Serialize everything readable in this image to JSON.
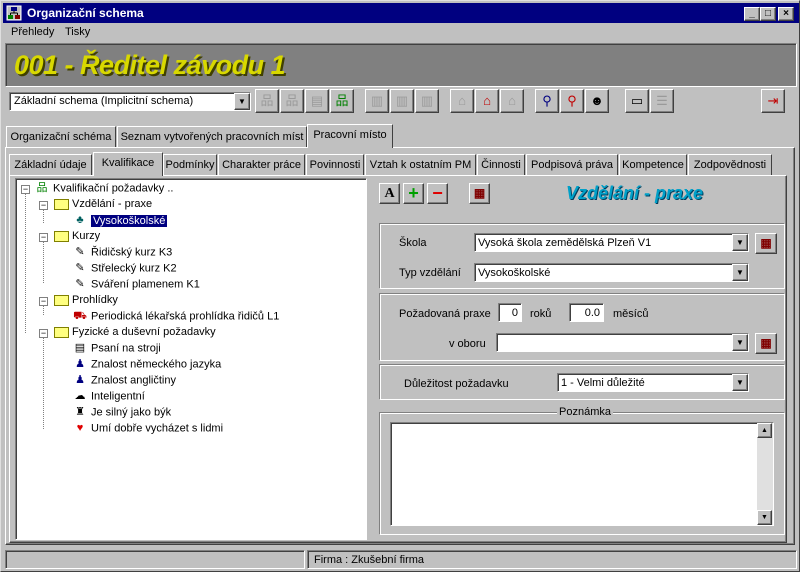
{
  "window": {
    "title": "Organizační schema",
    "min": "_",
    "max": "□",
    "close": "×"
  },
  "menu": [
    "Přehledy",
    "Tisky"
  ],
  "header": {
    "title": "001 - Ředitel závodu 1"
  },
  "toolbar": {
    "schema_value": "Základní schema  (Implicitní schema)"
  },
  "main_tabs": [
    "Organizační schéma",
    "Seznam vytvořených pracovních míst",
    "Pracovní místo"
  ],
  "sub_tabs": [
    "Základní údaje",
    "Kvalifikace",
    "Podmínky",
    "Charakter práce",
    "Povinnosti",
    "Vztah k ostatním PM",
    "Činnosti",
    "Podpisová práva",
    "Kompetence",
    "Zodpovědnosti"
  ],
  "tree": {
    "root": "Kvalifikační požadavky ..",
    "vzdelani": "Vzdělání - praxe",
    "vysokoskolske": "Vysokoškolské",
    "kurzy": "Kurzy",
    "kurz1": "Řidičský kurz K3",
    "kurz2": "Střelecký kurz K2",
    "kurz3": "Sváření plamenem K1",
    "prohlidky": "Prohlídky",
    "prohlidka1": "Periodická lékařská prohlídka řidičů L1",
    "fyzicke": "Fyzické a duševní požadavky",
    "f1": "Psaní na stroji",
    "f2": "Znalost německého jazyka",
    "f3": "Znalost angličtiny",
    "f4": "Inteligentní",
    "f5": "Je silný jako býk",
    "f6": "Umí dobře vycházet s lidmi"
  },
  "detail": {
    "title": "Vzdělání - praxe",
    "btn_a": "A",
    "btn_add": "+",
    "btn_del": "−",
    "skola_label": "Škola",
    "skola_value": "Vysoká škola zemědělská Plzeň  V1",
    "typ_label": "Typ vzdělání",
    "typ_value": "Vysokoškolské",
    "praxe_label": "Požadovaná praxe",
    "roky_value": "0",
    "roky_label": "roků",
    "mesice_value": "0.0",
    "mesice_label": "měsíců",
    "obor_label": "v oboru",
    "obor_value": "",
    "dulezitost_label": "Důležitost požadavku",
    "dulezitost_value": "1 - Velmi důležité",
    "poznamka_label": "Poznámka"
  },
  "status": {
    "firma": "Firma :  Zkušební firma"
  }
}
